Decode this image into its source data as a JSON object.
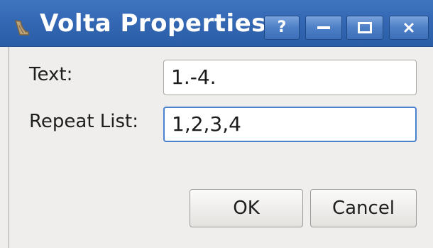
{
  "window": {
    "title": "Volta Properties",
    "icon": "harp-icon",
    "titlebar_color": "#3468b4",
    "controls": {
      "help": "?",
      "minimize": "minimize-icon",
      "maximize": "maximize-icon",
      "close": "close-icon"
    }
  },
  "form": {
    "text_label": "Text:",
    "text_value": "1.-4.",
    "repeat_label": "Repeat List:",
    "repeat_value": "1,2,3,4",
    "focus_color": "#4a82d0"
  },
  "buttons": {
    "ok": "OK",
    "cancel": "Cancel"
  }
}
